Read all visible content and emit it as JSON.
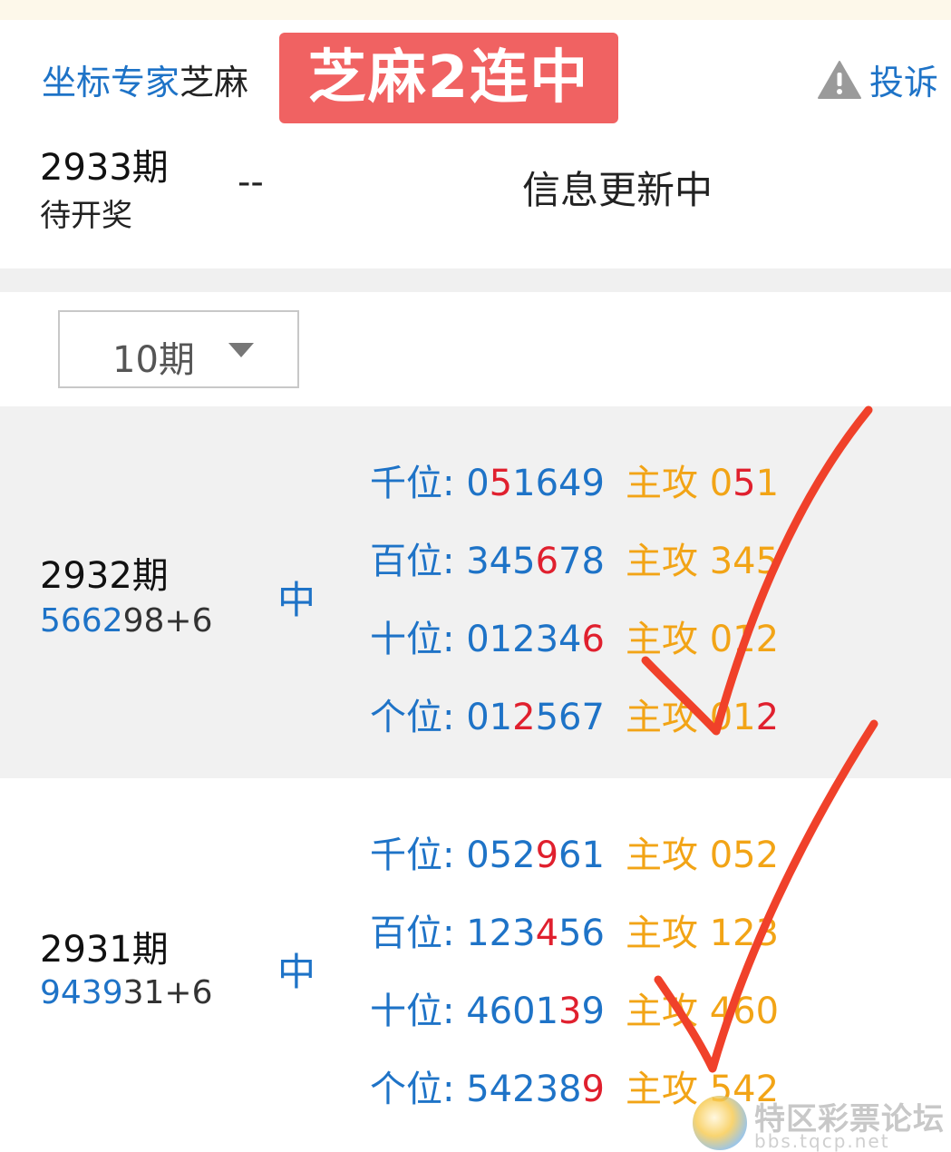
{
  "header": {
    "expert_label": "坐标专家",
    "expert_name": "芝麻",
    "badge": "芝麻2连中",
    "complain_label": "投诉"
  },
  "pending": {
    "issue": "2933期",
    "status": "待开奖",
    "dash": "--",
    "info": "信息更新中"
  },
  "filter": {
    "selected": "10期"
  },
  "records": [
    {
      "issue": "2932期",
      "draw_hl": "5662",
      "draw_rest": "98+6",
      "result": "中",
      "lines": [
        {
          "label": "千位:",
          "digits": "051649",
          "main_label": "主攻",
          "main": "051"
        },
        {
          "label": "百位:",
          "digits": "345678",
          "main_label": "主攻",
          "main": "345"
        },
        {
          "label": "十位:",
          "digits": "012346",
          "main_label": "主攻",
          "main": "012"
        },
        {
          "label": "个位:",
          "digits": "012567",
          "main_label": "主攻",
          "main": "012"
        }
      ]
    },
    {
      "issue": "2931期",
      "draw_hl": "9439",
      "draw_rest": "31+6",
      "result": "中",
      "lines": [
        {
          "label": "千位:",
          "digits": "052961",
          "main_label": "主攻",
          "main": "052"
        },
        {
          "label": "百位:",
          "digits": "123456",
          "main_label": "主攻",
          "main": "123"
        },
        {
          "label": "十位:",
          "digits": "460139",
          "main_label": "主攻",
          "main": "460"
        },
        {
          "label": "个位:",
          "digits": "542389",
          "main_label": "主攻",
          "main": "542"
        }
      ]
    }
  ],
  "watermark": {
    "title": "特区彩票论坛",
    "url": "bbs.tqcp.net"
  },
  "colors": {
    "blue": "#1e73c7",
    "orange": "#f2a416",
    "red": "#e0202e",
    "badge_bg": "#f06262",
    "check_stroke": "#f0412a"
  },
  "icons": [
    "warning-triangle-icon",
    "dropdown-caret-icon",
    "checkmark-annotation"
  ]
}
